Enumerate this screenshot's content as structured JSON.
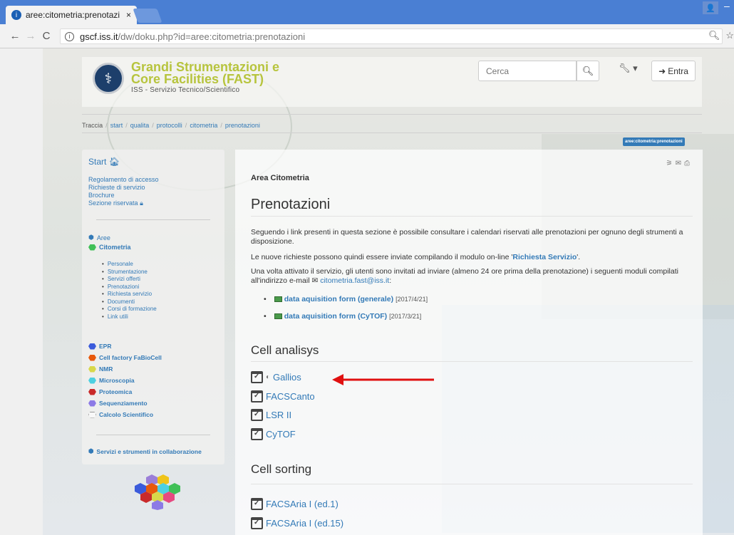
{
  "browser": {
    "tab_title": "aree:citometria:prenotazi",
    "tab_close": "×",
    "url_host": "gscf.iss.it",
    "url_path": "/dw/doku.php?id=aree:citometria:prenotazioni"
  },
  "header": {
    "title_line1": "Grandi Strumentazioni e",
    "title_line2": "Core Facilities (FAST)",
    "subtitle": "ISS - Servizio Tecnico/Scientifico",
    "search_placeholder": "Cerca",
    "login_label": "Entra"
  },
  "breadcrumb": {
    "label": "Traccia",
    "items": [
      "start",
      "qualita",
      "protocolli",
      "citometria",
      "prenotazioni"
    ]
  },
  "pagename": "aree:citometria:prenotazioni",
  "sidebar": {
    "start_label": "Start",
    "links": [
      "Regolamento di accesso",
      "Richieste di servizio",
      "Brochure",
      "Sezione riservata"
    ],
    "aree_label": "Aree",
    "citometria_label": "Citometria",
    "citometria_items": [
      "Personale",
      "Strumentazione",
      "Servizi offerti",
      "Prenotazioni",
      "Richiesta servizio",
      "Documenti",
      "Corsi di formazione",
      "Link utili"
    ],
    "areas": [
      {
        "label": "EPR",
        "color": "#3b5bdb"
      },
      {
        "label": "Cell factory FaBioCell",
        "color": "#e8590c"
      },
      {
        "label": "NMR",
        "color": "#d8d84a"
      },
      {
        "label": "Microscopia",
        "color": "#4dd0e1"
      },
      {
        "label": "Proteomica",
        "color": "#c92a2a"
      },
      {
        "label": "Sequenziamento",
        "color": "#8c7ae6"
      },
      {
        "label": "Calcolo Scientifico",
        "color": "#f8f8f8"
      }
    ],
    "collab_label": "Servizi e strumenti in collaborazione"
  },
  "content": {
    "area_label": "Area Citometria",
    "title": "Prenotazioni",
    "para1": "Seguendo i link presenti in questa sezione è possibile consultare i calendari riservati alle prenotazioni per ognuno degli strumenti a disposizione.",
    "para2_prefix": "Le nuove richieste possono quindi essere inviate compilando il modulo on-line '",
    "para2_link": "Richiesta Servizio",
    "para2_suffix": "'.",
    "para3": "Una volta attivato il servizio, gli utenti sono invitati ad inviare (almeno 24 ore prima della prenotazione) i seguenti moduli compilati all'indirizzo e-mail",
    "email": "citometria.fast@iss.it",
    "email_suffix": ":",
    "downloads": [
      {
        "label": "data aquisition form (generale)",
        "date": "[2017/4/21]"
      },
      {
        "label": "data aquisition form (CyTOF)",
        "date": "[2017/3/21]"
      }
    ],
    "section1_title": "Cell analisys",
    "section1_items": [
      "Gallios",
      "FACSCanto",
      "LSR II",
      "CyTOF"
    ],
    "section2_title": "Cell sorting",
    "section2_items": [
      "FACSAria I (ed.1)",
      "FACSAria I (ed.15)"
    ]
  }
}
